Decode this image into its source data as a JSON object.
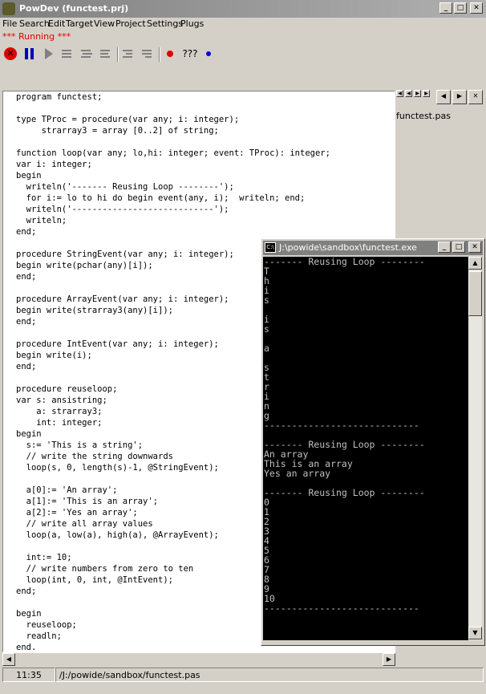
{
  "window": {
    "title": "PowDev (functest.prj)"
  },
  "menu": [
    "File",
    "Search",
    "Edit",
    "Target",
    "View",
    "Project",
    "Settings",
    "Plugs"
  ],
  "status_running": "*** Running ***",
  "toolbar": {
    "unknown_label": "???"
  },
  "editor": {
    "code": "program functest;\n\ntype TProc = procedure(var any; i: integer);\n     strarray3 = array [0..2] of string;\n\nfunction loop(var any; lo,hi: integer; event: TProc): integer;\nvar i: integer;\nbegin\n  writeln('------- Reusing Loop --------');\n  for i:= lo to hi do begin event(any, i);  writeln; end;\n  writeln('----------------------------');\n  writeln;\nend;\n\nprocedure StringEvent(var any; i: integer);\nbegin write(pchar(any)[i]);\nend;\n\nprocedure ArrayEvent(var any; i: integer);\nbegin write(strarray3(any)[i]);\nend;\n\nprocedure IntEvent(var any; i: integer);\nbegin write(i);\nend;\n\nprocedure reuseloop;\nvar s: ansistring;\n    a: strarray3;\n    int: integer;\nbegin\n  s:= 'This is a string';\n  // write the string downwards\n  loop(s, 0, length(s)-1, @StringEvent);\n\n  a[0]:= 'An array';\n  a[1]:= 'This is an array';\n  a[2]:= 'Yes an array';\n  // write all array values\n  loop(a, low(a), high(a), @ArrayEvent);\n\n  int:= 10;\n  // write numbers from zero to ten\n  loop(int, 0, int, @IntEvent);\nend;\n\nbegin\n  reuseloop;\n  readln;\nend."
  },
  "file_tab": "functest.pas",
  "statusbar": {
    "position": "11:35",
    "path": "/J:/powide/sandbox/functest.pas"
  },
  "console": {
    "title": "J:\\powide\\sandbox\\functest.exe",
    "output": "------- Reusing Loop --------\nT\nh\ni\ns\n \ni\ns\n \na\n \ns\nt\nr\ni\nn\ng\n----------------------------\n\n------- Reusing Loop --------\nAn array\nThis is an array\nYes an array\n\n------- Reusing Loop --------\n0\n1\n2\n3\n4\n5\n6\n7\n8\n9\n10\n----------------------------"
  },
  "colors": {
    "running": "#e00000",
    "console_bg": "#000000",
    "console_fg": "#c0c0c0"
  }
}
